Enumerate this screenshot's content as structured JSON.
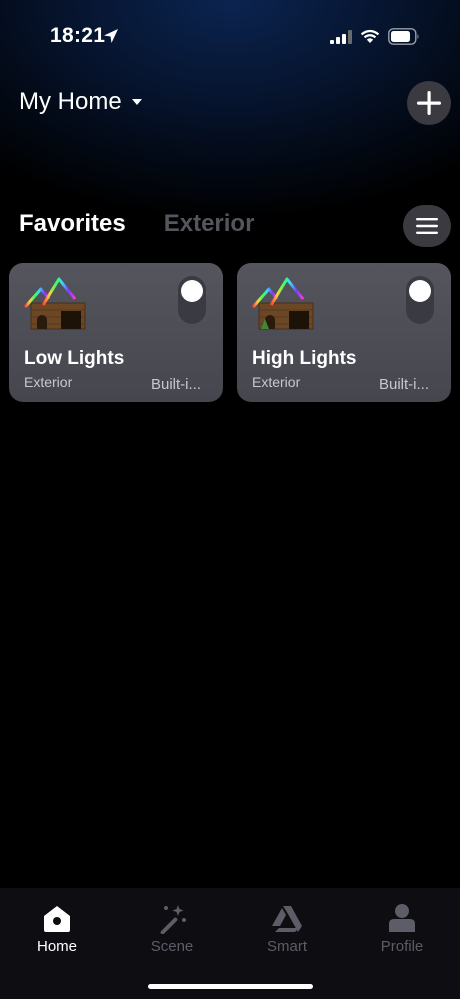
{
  "status_bar": {
    "time": "18:21"
  },
  "header": {
    "home_name": "My Home"
  },
  "tabs": [
    {
      "label": "Favorites",
      "active": true
    },
    {
      "label": "Exterior",
      "active": false
    }
  ],
  "devices": [
    {
      "name": "Low Lights",
      "room": "Exterior",
      "type": "Built-i...",
      "on": false
    },
    {
      "name": "High Lights",
      "room": "Exterior",
      "type": "Built-i...",
      "on": false
    }
  ],
  "nav": [
    {
      "label": "Home",
      "icon": "home-icon",
      "active": true
    },
    {
      "label": "Scene",
      "icon": "magic-wand-icon",
      "active": false
    },
    {
      "label": "Smart",
      "icon": "smart-triangle-icon",
      "active": false
    },
    {
      "label": "Profile",
      "icon": "profile-icon",
      "active": false
    }
  ],
  "colors": {
    "card_bg": "#4e4e56",
    "tab_inactive": "#55565d",
    "nav_inactive": "#5c5d66"
  }
}
